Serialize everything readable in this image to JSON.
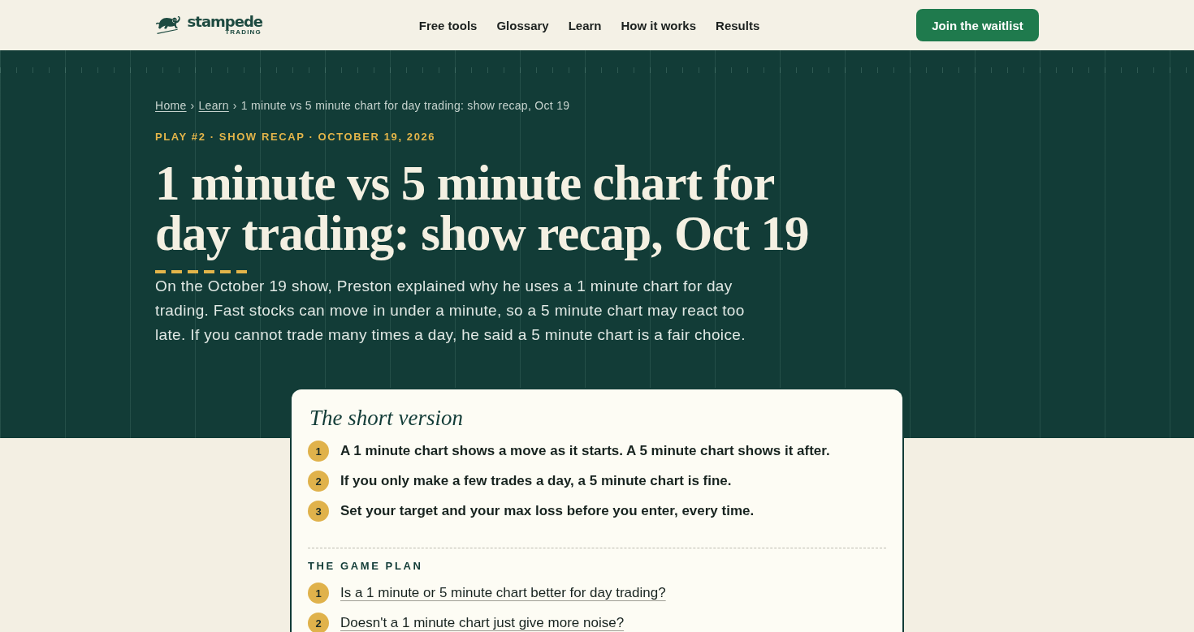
{
  "header": {
    "logo": {
      "wordmark": "stampede",
      "tagline": "TRADING"
    },
    "nav": [
      "Free tools",
      "Glossary",
      "Learn",
      "How it works",
      "Results"
    ],
    "cta": "Join the waitlist"
  },
  "hero": {
    "breadcrumb": [
      {
        "kind": "link",
        "label": "Home"
      },
      {
        "kind": "separator",
        "label": "›"
      },
      {
        "kind": "link",
        "label": "Learn"
      },
      {
        "kind": "separator",
        "label": "›"
      },
      {
        "kind": "current",
        "label": "1 minute vs 5 minute chart for day trading: show recap, Oct 19"
      }
    ],
    "kicker": "PLAY #2 · SHOW RECAP · OCTOBER 19, 2026",
    "title": "1 minute vs 5 minute chart for day trading: show recap, Oct 19",
    "summary": "On the October 19 show, Preston explained why he uses a 1 minute chart for day trading. Fast stocks can move in under a minute, so a 5 minute chart may react too late. If you cannot trade many times a day, he said a 5 minute chart is a fair choice."
  },
  "summary_card": {
    "title": "The short version",
    "points": [
      {
        "number": "1",
        "text": "A 1 minute chart shows a move as it starts. A 5 minute chart shows it after."
      },
      {
        "number": "2",
        "text": "If you only make a few trades a day, a 5 minute chart is fine."
      },
      {
        "number": "3",
        "text": "Set your target and your max loss before you enter, every time."
      }
    ],
    "game_plan": {
      "heading": "THE GAME PLAN",
      "questions": [
        {
          "number": "1",
          "text": "Is a 1 minute or 5 minute chart better for day trading?"
        },
        {
          "number": "2",
          "text": "Doesn't a 1 minute chart just give more noise?"
        }
      ]
    }
  }
}
